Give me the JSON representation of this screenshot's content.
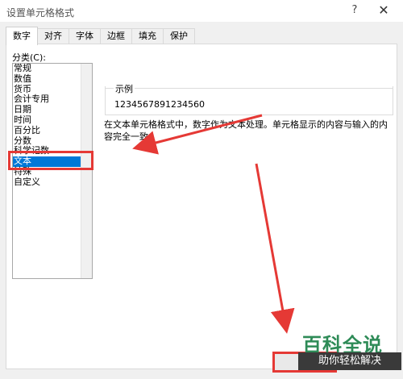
{
  "window": {
    "title": "设置单元格格式",
    "help_icon": "?",
    "close_icon": "✕"
  },
  "tabs": [
    {
      "label": "数字",
      "active": true
    },
    {
      "label": "对齐"
    },
    {
      "label": "字体"
    },
    {
      "label": "边框"
    },
    {
      "label": "填充"
    },
    {
      "label": "保护"
    }
  ],
  "category": {
    "label": "分类(C):",
    "items": [
      "常规",
      "数值",
      "货币",
      "会计专用",
      "日期",
      "时间",
      "百分比",
      "分数",
      "科学记数",
      "文本",
      "特殊",
      "自定义"
    ],
    "selected_index": 9
  },
  "sample": {
    "legend": "示例",
    "value": "1234567891234560"
  },
  "description": "在文本单元格格式中，数字作为文本处理。单元格显示的内容与输入的内容完全一致。",
  "watermark": {
    "title": "百科全说",
    "subtitle": "助你轻松解决"
  },
  "colors": {
    "selection": "#0078d7",
    "annotation_red": "#e53935",
    "watermark_green": "#2e8b57"
  }
}
